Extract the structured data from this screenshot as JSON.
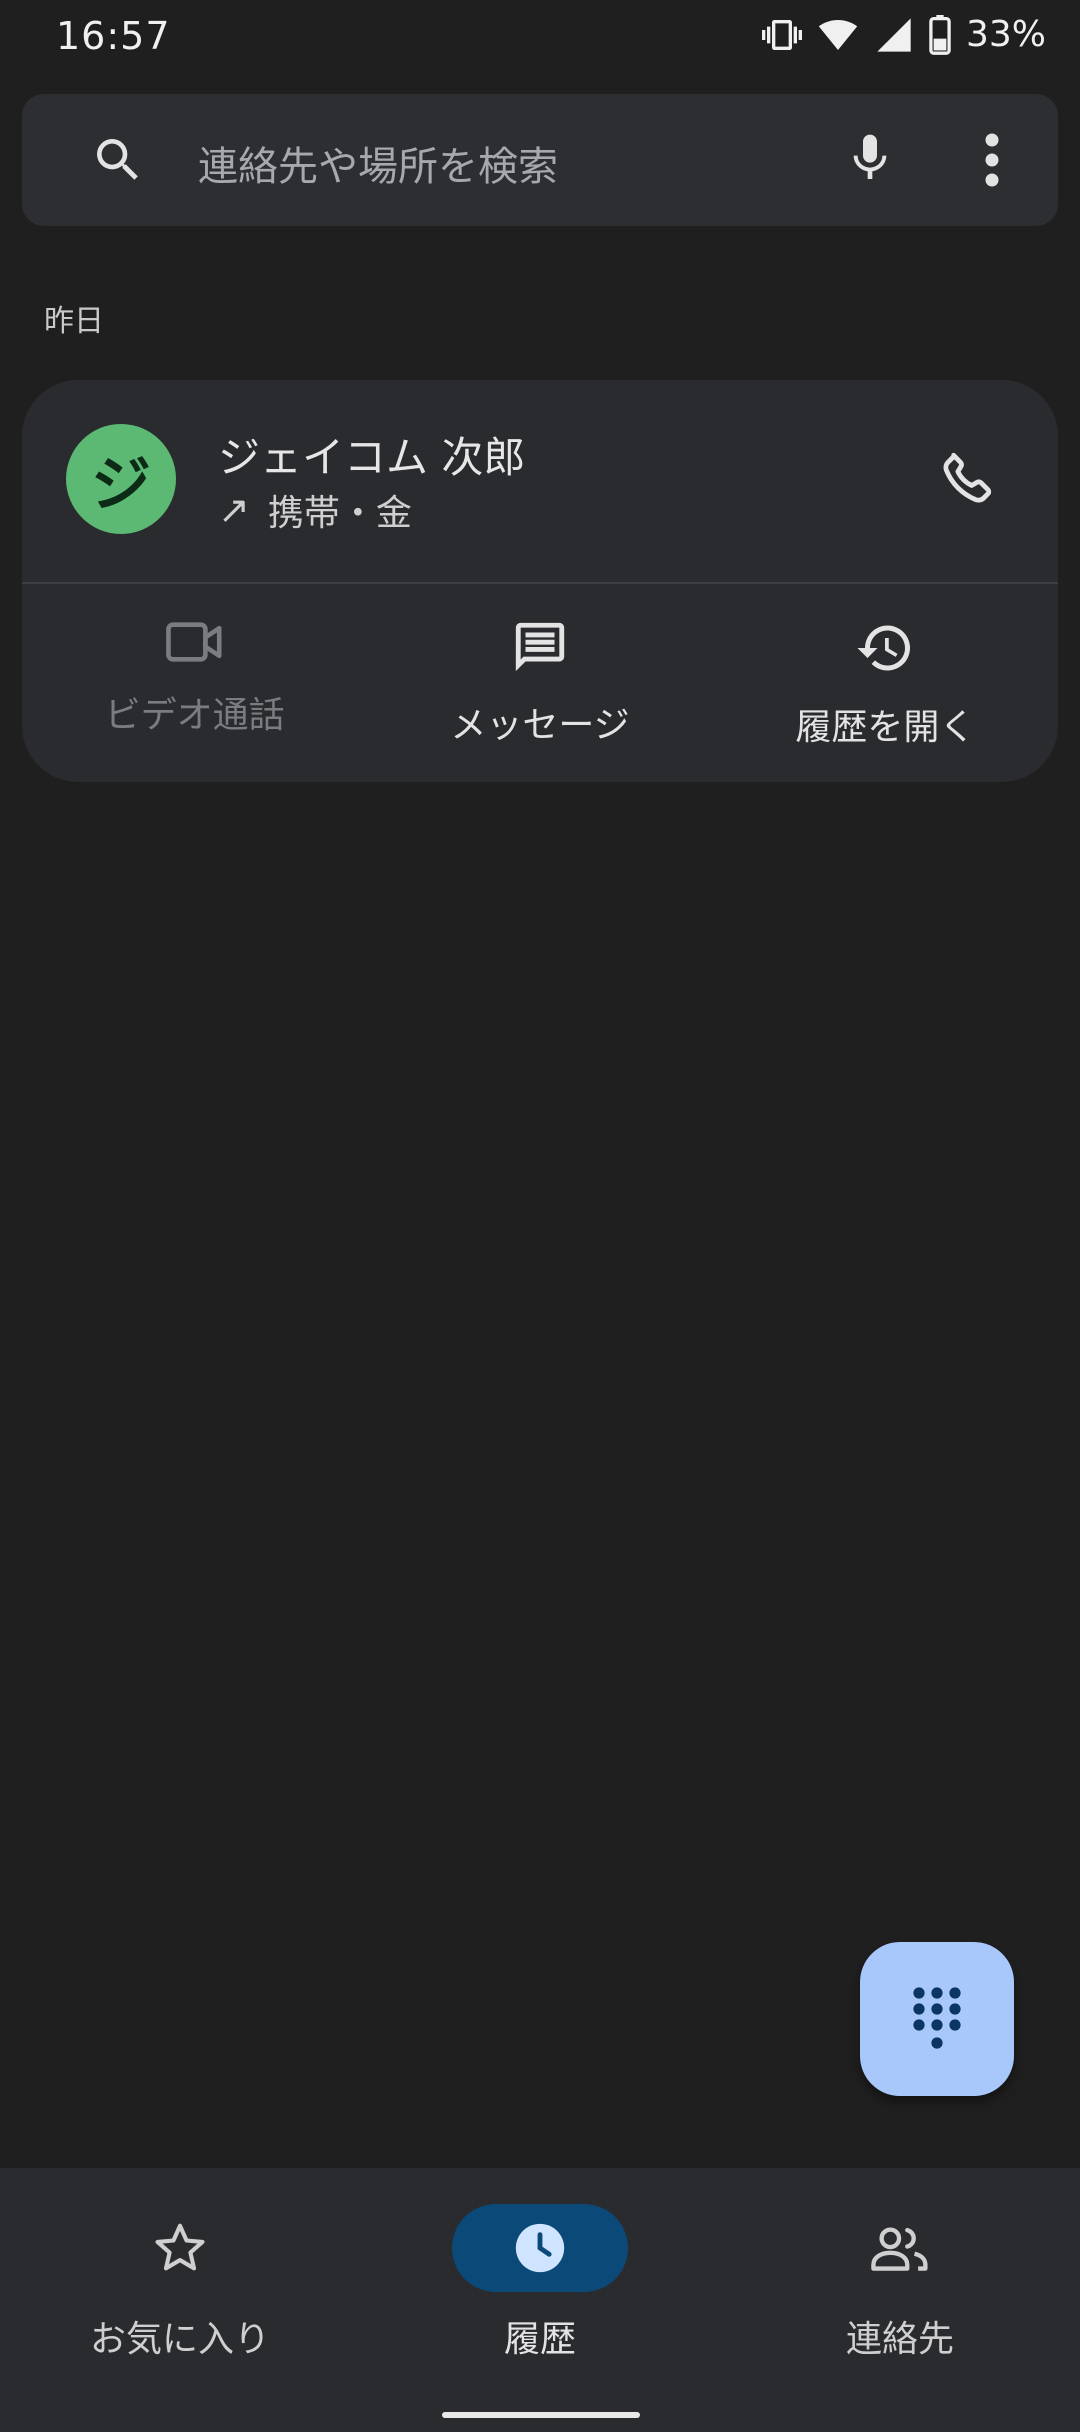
{
  "status": {
    "time": "16:57",
    "battery": "33%"
  },
  "search": {
    "placeholder": "連絡先や場所を検索"
  },
  "section": {
    "date": "昨日"
  },
  "call": {
    "avatar_letter": "ジ",
    "name": "ジェイコム 次郎",
    "direction_arrow": "↗",
    "meta": "携帯・金"
  },
  "actions": [
    {
      "label": "ビデオ通話",
      "enabled": false
    },
    {
      "label": "メッセージ",
      "enabled": true
    },
    {
      "label": "履歴を開く",
      "enabled": true
    }
  ],
  "nav": {
    "favorites": "お気に入り",
    "history": "履歴",
    "contacts": "連絡先"
  },
  "colors": {
    "background": "#1f1f1f",
    "card": "#2a2b2e",
    "avatar": "#5bb974",
    "fab": "#a8c7fa",
    "nav_active": "#0b4a78"
  }
}
